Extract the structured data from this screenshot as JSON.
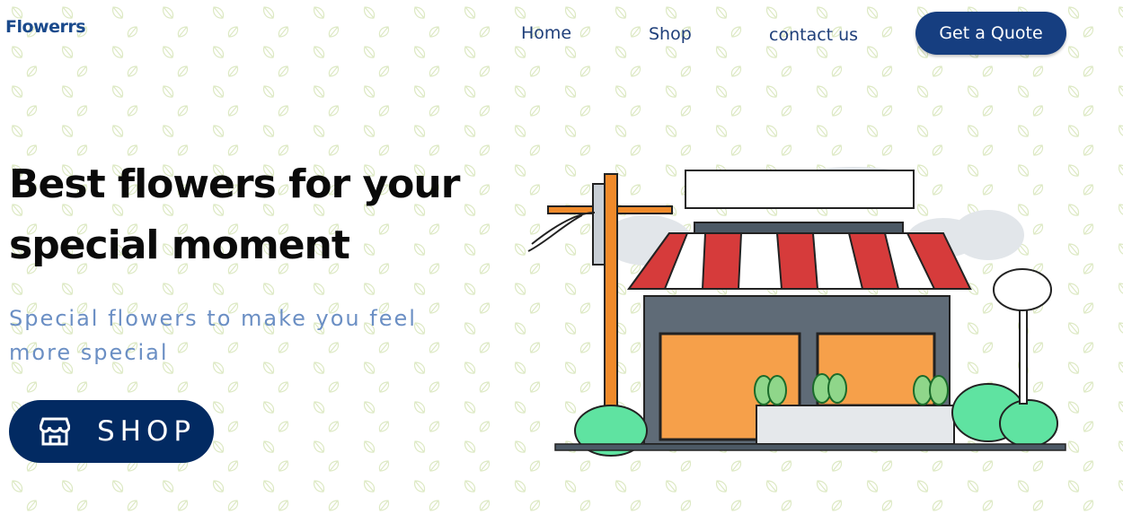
{
  "header": {
    "logo": "Flowerrs",
    "nav": [
      "Home",
      "Shop",
      "contact us"
    ],
    "cta": "Get a Quote"
  },
  "hero": {
    "title_line1": "Best flowers for your",
    "title_line2": "special  moment",
    "subtitle_line1": "Special flowers to make you feel",
    "subtitle_line2": "more special",
    "shop_button": "SHOP",
    "shop_icon": "storefront-icon"
  },
  "colors": {
    "brand": "#163e80",
    "button": "#022a62",
    "subtitle": "#6b8fc4",
    "leaf_pattern": "#d9e8b8",
    "awning_red": "#d63b3b"
  }
}
